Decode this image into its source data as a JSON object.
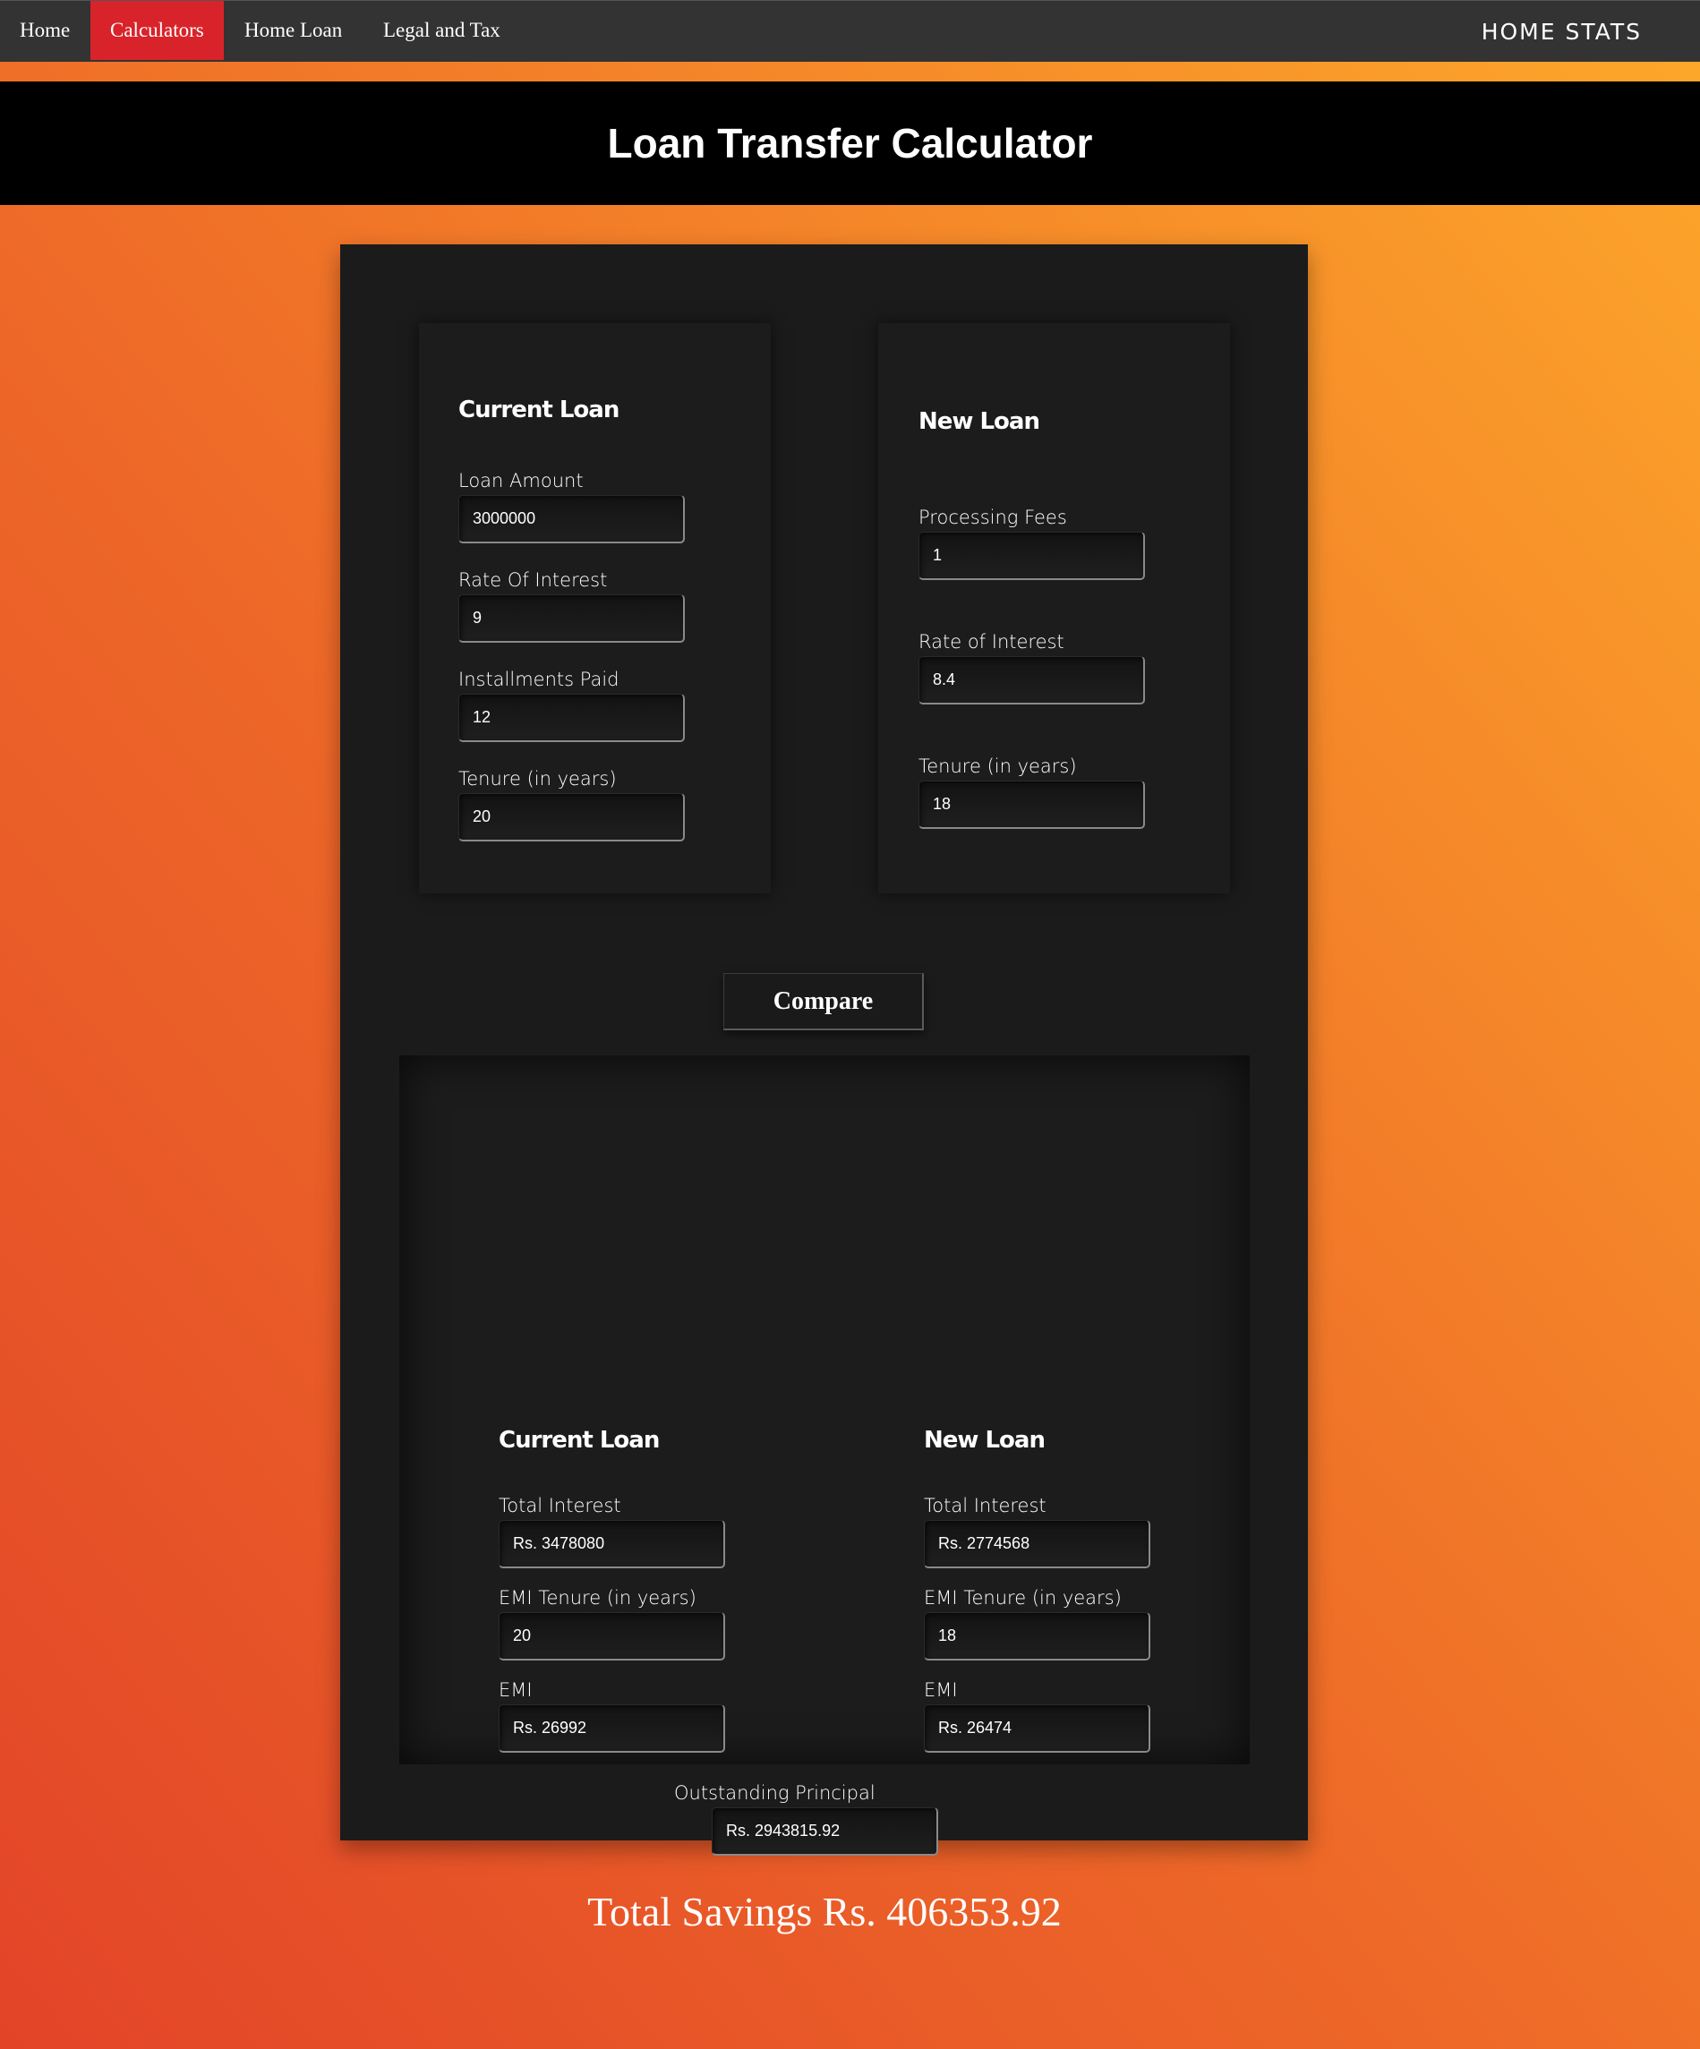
{
  "nav": {
    "items": [
      "Home",
      "Calculators",
      "Home Loan",
      "Legal and Tax"
    ],
    "active_item": "Calculators",
    "brand": "HOME STATS"
  },
  "header": {
    "title": "Loan Transfer Calculator"
  },
  "current_loan": {
    "title": "Current Loan",
    "loan_amount": {
      "label": "Loan Amount",
      "value": "3000000"
    },
    "rate_of_interest": {
      "label": "Rate Of Interest",
      "value": "9"
    },
    "installments_paid": {
      "label": "Installments Paid",
      "value": "12"
    },
    "tenure": {
      "label": "Tenure (in years)",
      "value": "20"
    }
  },
  "new_loan": {
    "title": "New Loan",
    "processing_fees": {
      "label": "Processing Fees",
      "value": "1"
    },
    "rate_of_interest": {
      "label": "Rate of Interest",
      "value": "8.4"
    },
    "tenure": {
      "label": "Tenure (in years)",
      "value": "18"
    }
  },
  "compare_button": "Compare",
  "results": {
    "current_loan": {
      "title": "Current Loan",
      "total_interest": {
        "label": "Total Interest",
        "value": "Rs. 3478080"
      },
      "emi_tenure": {
        "label": "EMI Tenure (in years)",
        "value": "20"
      },
      "emi": {
        "label": "EMI",
        "value": "Rs. 26992"
      }
    },
    "new_loan": {
      "title": "New Loan",
      "total_interest": {
        "label": "Total Interest",
        "value": "Rs. 2774568"
      },
      "emi_tenure": {
        "label": "EMI Tenure (in years)",
        "value": "18"
      },
      "emi": {
        "label": "EMI",
        "value": "Rs. 26474"
      }
    },
    "outstanding_principal": {
      "label": "Outstanding Principal",
      "value": "Rs. 2943815.92"
    },
    "total_savings": "Total Savings Rs. 406353.92"
  },
  "colors": {
    "nav_background": "#333333",
    "nav_active": "#d9232a",
    "header_background": "#000000",
    "card_background": "#1b1b1b",
    "gradient_start": "#e24428",
    "gradient_end": "#fda82a"
  }
}
